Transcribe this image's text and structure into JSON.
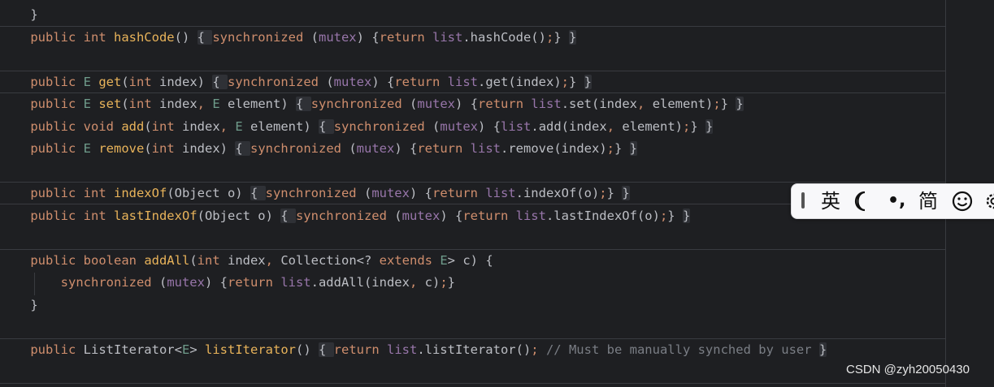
{
  "editor": {
    "lines": [
      {
        "tokens": [
          {
            "c": "pl",
            "t": "    }"
          }
        ]
      },
      {
        "tokens": [
          {
            "c": "kw",
            "t": "    public "
          },
          {
            "c": "kw",
            "t": "int "
          },
          {
            "c": "fn",
            "t": "hashCode"
          },
          {
            "c": "pl",
            "t": "() "
          },
          {
            "c": "fold",
            "t": "{ "
          },
          {
            "c": "kw",
            "t": "synchronized "
          },
          {
            "c": "pl",
            "t": "("
          },
          {
            "c": "fld",
            "t": "mutex"
          },
          {
            "c": "pl",
            "t": ") {"
          },
          {
            "c": "kw",
            "t": "return "
          },
          {
            "c": "fld",
            "t": "list"
          },
          {
            "c": "pl",
            "t": ".hashCode()"
          },
          {
            "c": "kw",
            "t": ";"
          },
          {
            "c": "pl",
            "t": "} "
          },
          {
            "c": "fold",
            "t": "}"
          }
        ]
      },
      {
        "tokens": []
      },
      {
        "tokens": [
          {
            "c": "kw",
            "t": "    public "
          },
          {
            "c": "tp",
            "t": "E "
          },
          {
            "c": "fn",
            "t": "get"
          },
          {
            "c": "pl",
            "t": "("
          },
          {
            "c": "kw",
            "t": "int "
          },
          {
            "c": "pl",
            "t": "index) "
          },
          {
            "c": "fold",
            "t": "{ "
          },
          {
            "c": "kw",
            "t": "synchronized "
          },
          {
            "c": "pl",
            "t": "("
          },
          {
            "c": "fld",
            "t": "mutex"
          },
          {
            "c": "pl",
            "t": ") {"
          },
          {
            "c": "kw",
            "t": "return "
          },
          {
            "c": "fld",
            "t": "list"
          },
          {
            "c": "pl",
            "t": ".get(index)"
          },
          {
            "c": "kw",
            "t": ";"
          },
          {
            "c": "pl",
            "t": "} "
          },
          {
            "c": "fold",
            "t": "}"
          }
        ]
      },
      {
        "tokens": [
          {
            "c": "kw",
            "t": "    public "
          },
          {
            "c": "tp",
            "t": "E "
          },
          {
            "c": "fn",
            "t": "set"
          },
          {
            "c": "pl",
            "t": "("
          },
          {
            "c": "kw",
            "t": "int "
          },
          {
            "c": "pl",
            "t": "index"
          },
          {
            "c": "kw",
            "t": ", "
          },
          {
            "c": "tp",
            "t": "E "
          },
          {
            "c": "pl",
            "t": "element) "
          },
          {
            "c": "fold",
            "t": "{ "
          },
          {
            "c": "kw",
            "t": "synchronized "
          },
          {
            "c": "pl",
            "t": "("
          },
          {
            "c": "fld",
            "t": "mutex"
          },
          {
            "c": "pl",
            "t": ") {"
          },
          {
            "c": "kw",
            "t": "return "
          },
          {
            "c": "fld",
            "t": "list"
          },
          {
            "c": "pl",
            "t": ".set(index"
          },
          {
            "c": "kw",
            "t": ", "
          },
          {
            "c": "pl",
            "t": "element)"
          },
          {
            "c": "kw",
            "t": ";"
          },
          {
            "c": "pl",
            "t": "} "
          },
          {
            "c": "fold",
            "t": "}"
          }
        ]
      },
      {
        "tokens": [
          {
            "c": "kw",
            "t": "    public "
          },
          {
            "c": "kw",
            "t": "void "
          },
          {
            "c": "fn",
            "t": "add"
          },
          {
            "c": "pl",
            "t": "("
          },
          {
            "c": "kw",
            "t": "int "
          },
          {
            "c": "pl",
            "t": "index"
          },
          {
            "c": "kw",
            "t": ", "
          },
          {
            "c": "tp",
            "t": "E "
          },
          {
            "c": "pl",
            "t": "element) "
          },
          {
            "c": "fold",
            "t": "{ "
          },
          {
            "c": "kw",
            "t": "synchronized "
          },
          {
            "c": "pl",
            "t": "("
          },
          {
            "c": "fld",
            "t": "mutex"
          },
          {
            "c": "pl",
            "t": ") {"
          },
          {
            "c": "fld",
            "t": "list"
          },
          {
            "c": "pl",
            "t": ".add(index"
          },
          {
            "c": "kw",
            "t": ", "
          },
          {
            "c": "pl",
            "t": "element)"
          },
          {
            "c": "kw",
            "t": ";"
          },
          {
            "c": "pl",
            "t": "} "
          },
          {
            "c": "fold",
            "t": "}"
          }
        ]
      },
      {
        "tokens": [
          {
            "c": "kw",
            "t": "    public "
          },
          {
            "c": "tp",
            "t": "E "
          },
          {
            "c": "fn",
            "t": "remove"
          },
          {
            "c": "pl",
            "t": "("
          },
          {
            "c": "kw",
            "t": "int "
          },
          {
            "c": "pl",
            "t": "index) "
          },
          {
            "c": "fold",
            "t": "{ "
          },
          {
            "c": "kw",
            "t": "synchronized "
          },
          {
            "c": "pl",
            "t": "("
          },
          {
            "c": "fld",
            "t": "mutex"
          },
          {
            "c": "pl",
            "t": ") {"
          },
          {
            "c": "kw",
            "t": "return "
          },
          {
            "c": "fld",
            "t": "list"
          },
          {
            "c": "pl",
            "t": ".remove(index)"
          },
          {
            "c": "kw",
            "t": ";"
          },
          {
            "c": "pl",
            "t": "} "
          },
          {
            "c": "fold",
            "t": "}"
          }
        ]
      },
      {
        "tokens": []
      },
      {
        "tokens": [
          {
            "c": "kw",
            "t": "    public "
          },
          {
            "c": "kw",
            "t": "int "
          },
          {
            "c": "fn",
            "t": "indexOf"
          },
          {
            "c": "pl",
            "t": "(Object o) "
          },
          {
            "c": "fold",
            "t": "{ "
          },
          {
            "c": "kw",
            "t": "synchronized "
          },
          {
            "c": "pl",
            "t": "("
          },
          {
            "c": "fld",
            "t": "mutex"
          },
          {
            "c": "pl",
            "t": ") {"
          },
          {
            "c": "kw",
            "t": "return "
          },
          {
            "c": "fld",
            "t": "list"
          },
          {
            "c": "pl",
            "t": ".indexOf(o)"
          },
          {
            "c": "kw",
            "t": ";"
          },
          {
            "c": "pl",
            "t": "} "
          },
          {
            "c": "fold",
            "t": "}"
          }
        ]
      },
      {
        "tokens": [
          {
            "c": "kw",
            "t": "    public "
          },
          {
            "c": "kw",
            "t": "int "
          },
          {
            "c": "fn",
            "t": "lastIndexOf"
          },
          {
            "c": "pl",
            "t": "(Object o) "
          },
          {
            "c": "fold",
            "t": "{ "
          },
          {
            "c": "kw",
            "t": "synchronized "
          },
          {
            "c": "pl",
            "t": "("
          },
          {
            "c": "fld",
            "t": "mutex"
          },
          {
            "c": "pl",
            "t": ") {"
          },
          {
            "c": "kw",
            "t": "return "
          },
          {
            "c": "fld",
            "t": "list"
          },
          {
            "c": "pl",
            "t": ".lastIndexOf(o)"
          },
          {
            "c": "kw",
            "t": ";"
          },
          {
            "c": "pl",
            "t": "} "
          },
          {
            "c": "fold",
            "t": "}"
          }
        ]
      },
      {
        "tokens": []
      },
      {
        "tokens": [
          {
            "c": "kw",
            "t": "    public "
          },
          {
            "c": "kw",
            "t": "boolean "
          },
          {
            "c": "fn",
            "t": "addAll"
          },
          {
            "c": "pl",
            "t": "("
          },
          {
            "c": "kw",
            "t": "int "
          },
          {
            "c": "pl",
            "t": "index"
          },
          {
            "c": "kw",
            "t": ", "
          },
          {
            "c": "pl",
            "t": "Collection<? "
          },
          {
            "c": "kw",
            "t": "extends "
          },
          {
            "c": "tp",
            "t": "E"
          },
          {
            "c": "pl",
            "t": "> c) {"
          }
        ]
      },
      {
        "tokens": [
          {
            "c": "kw",
            "t": "        synchronized "
          },
          {
            "c": "pl",
            "t": "("
          },
          {
            "c": "fld",
            "t": "mutex"
          },
          {
            "c": "pl",
            "t": ") {"
          },
          {
            "c": "kw",
            "t": "return "
          },
          {
            "c": "fld",
            "t": "list"
          },
          {
            "c": "pl",
            "t": ".addAll(index"
          },
          {
            "c": "kw",
            "t": ", "
          },
          {
            "c": "pl",
            "t": "c)"
          },
          {
            "c": "kw",
            "t": ";"
          },
          {
            "c": "pl",
            "t": "}"
          }
        ]
      },
      {
        "tokens": [
          {
            "c": "pl",
            "t": "    }"
          }
        ]
      },
      {
        "tokens": []
      },
      {
        "tokens": [
          {
            "c": "kw",
            "t": "    public "
          },
          {
            "c": "pl",
            "t": "ListIterator<"
          },
          {
            "c": "tp",
            "t": "E"
          },
          {
            "c": "pl",
            "t": "> "
          },
          {
            "c": "fn",
            "t": "listIterator"
          },
          {
            "c": "pl",
            "t": "() "
          },
          {
            "c": "fold",
            "t": "{ "
          },
          {
            "c": "kw",
            "t": "return "
          },
          {
            "c": "fld",
            "t": "list"
          },
          {
            "c": "pl",
            "t": ".listIterator()"
          },
          {
            "c": "kw",
            "t": "; "
          },
          {
            "c": "cm",
            "t": "// Must be manually synched by user "
          },
          {
            "c": "fold",
            "t": "}"
          }
        ]
      }
    ]
  },
  "ime": {
    "lang_label": "英",
    "moon_icon": "moon-icon",
    "punct_label": "•,",
    "mode_label": "简",
    "emoji_icon": "smiley-icon",
    "settings_icon": "gear-icon"
  },
  "watermark": "CSDN @zyh20050430",
  "colors": {
    "background": "#1e1f22",
    "keyword": "#cf8e6d",
    "function": "#e8b35a",
    "field": "#9876aa",
    "type_param": "#6f9c8b",
    "comment": "#7a7e85",
    "text": "#bcbec4"
  }
}
